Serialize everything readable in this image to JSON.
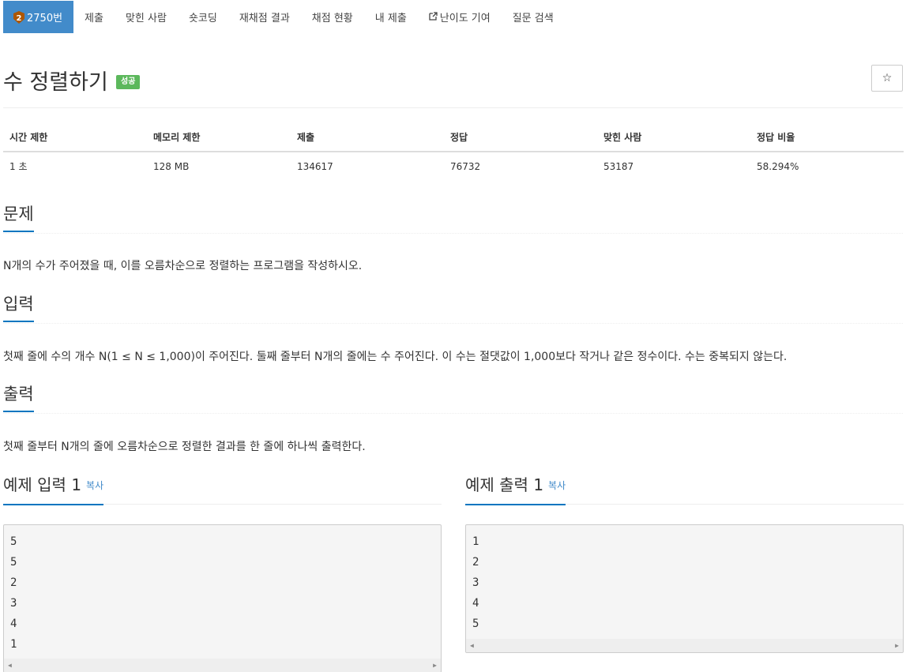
{
  "nav": {
    "tabs": [
      {
        "label": "2750번",
        "badge": "2",
        "active": true
      },
      {
        "label": "제출"
      },
      {
        "label": "맞힌 사람"
      },
      {
        "label": "숏코딩"
      },
      {
        "label": "재채점 결과"
      },
      {
        "label": "채점 현황"
      },
      {
        "label": "내 제출"
      },
      {
        "label": "난이도 기여",
        "icon": "external-link-icon"
      },
      {
        "label": "질문 검색"
      }
    ]
  },
  "problem": {
    "title": "수 정렬하기",
    "status_label": "성공",
    "star_icon": "☆"
  },
  "info": {
    "headers": [
      "시간 제한",
      "메모리 제한",
      "제출",
      "정답",
      "맞힌 사람",
      "정답 비율"
    ],
    "values": [
      "1 초",
      "128 MB",
      "134617",
      "76732",
      "53187",
      "58.294%"
    ]
  },
  "sections": {
    "description": {
      "heading": "문제",
      "text": "N개의 수가 주어졌을 때, 이를 오름차순으로 정렬하는 프로그램을 작성하시오."
    },
    "input": {
      "heading": "입력",
      "text": "첫째 줄에 수의 개수 N(1 ≤ N ≤ 1,000)이 주어진다. 둘째 줄부터 N개의 줄에는 수 주어진다. 이 수는 절댓값이 1,000보다 작거나 같은 정수이다. 수는 중복되지 않는다."
    },
    "output": {
      "heading": "출력",
      "text": "첫째 줄부터 N개의 줄에 오름차순으로 정렬한 결과를 한 줄에 하나씩 출력한다."
    }
  },
  "samples": {
    "copy_label": "복사",
    "input": {
      "heading": "예제 입력 1",
      "lines": [
        "5",
        "5",
        "2",
        "3",
        "4",
        "1"
      ]
    },
    "output": {
      "heading": "예제 출력 1",
      "lines": [
        "1",
        "2",
        "3",
        "4",
        "5"
      ]
    }
  },
  "colors": {
    "accent": "#428bca",
    "success": "#5cb85c",
    "underline": "#0076c0",
    "tier_bronze": "#ad5600"
  }
}
